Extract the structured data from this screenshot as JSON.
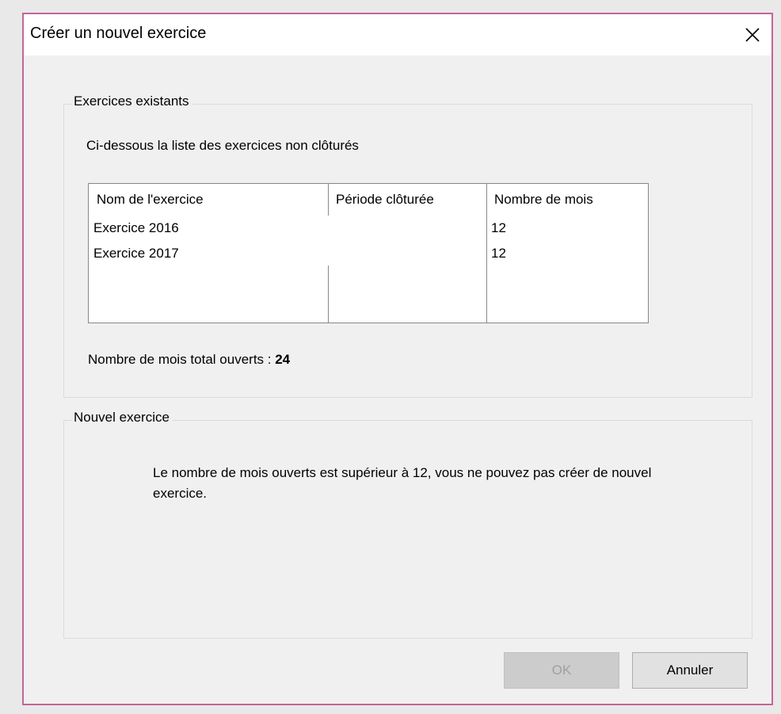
{
  "window": {
    "title": "Créer un nouvel exercice",
    "close_icon": "close-icon"
  },
  "existing": {
    "legend": "Exercices existants",
    "description": "Ci-dessous la liste des exercices non clôturés",
    "columns": [
      "Nom de l'exercice",
      "Période clôturée",
      "Nombre de mois"
    ],
    "rows": [
      {
        "name": "Exercice 2016",
        "period": "",
        "months": "12"
      },
      {
        "name": "Exercice 2017",
        "period": "",
        "months": "12"
      }
    ],
    "total_label": "Nombre de mois total ouverts : ",
    "total_value": "24"
  },
  "new_exercise": {
    "legend": "Nouvel exercice",
    "message": "Le nombre de mois ouverts est supérieur à 12, vous ne pouvez pas créer de nouvel exercice."
  },
  "buttons": {
    "ok": "OK",
    "cancel": "Annuler"
  }
}
